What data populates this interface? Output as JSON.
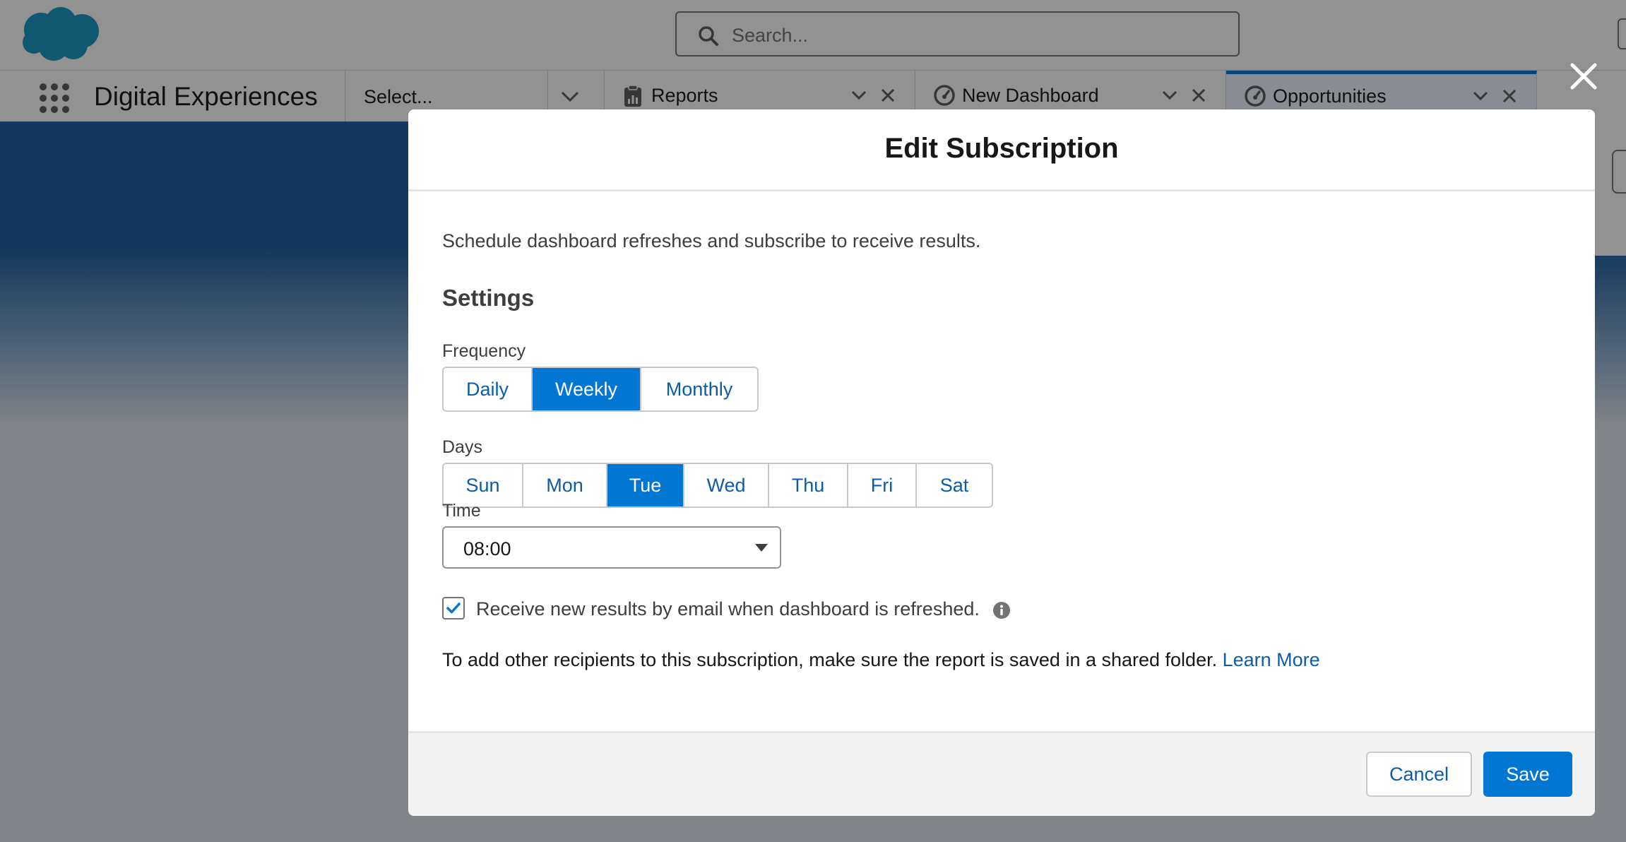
{
  "header": {
    "search_placeholder": "Search...",
    "app_name": "Digital Experiences"
  },
  "nav": {
    "select_label": "Select...",
    "tabs": [
      {
        "label": "Reports",
        "icon": "report-icon",
        "active": false
      },
      {
        "label": "New Dashboard",
        "icon": "dashboard-icon",
        "active": false
      },
      {
        "label": "Opportunities",
        "icon": "dashboard-icon",
        "active": true
      }
    ]
  },
  "modal": {
    "title": "Edit Subscription",
    "intro": "Schedule dashboard refreshes and subscribe to receive results.",
    "section_title": "Settings",
    "frequency": {
      "label": "Frequency",
      "options": [
        "Daily",
        "Weekly",
        "Monthly"
      ],
      "selected": "Weekly"
    },
    "days": {
      "label": "Days",
      "options": [
        "Sun",
        "Mon",
        "Tue",
        "Wed",
        "Thu",
        "Fri",
        "Sat"
      ],
      "selected": "Tue"
    },
    "time": {
      "label": "Time",
      "value": "08:00"
    },
    "email_checkbox": {
      "label": "Receive new results by email when dashboard is refreshed.",
      "checked": true
    },
    "recipients_note": "To add other recipients to this subscription, make sure the report is saved in a shared folder.",
    "learn_more": "Learn More",
    "cancel_label": "Cancel",
    "save_label": "Save"
  },
  "colors": {
    "brand_blue": "#0176d3",
    "link_blue": "#0b5cab"
  }
}
